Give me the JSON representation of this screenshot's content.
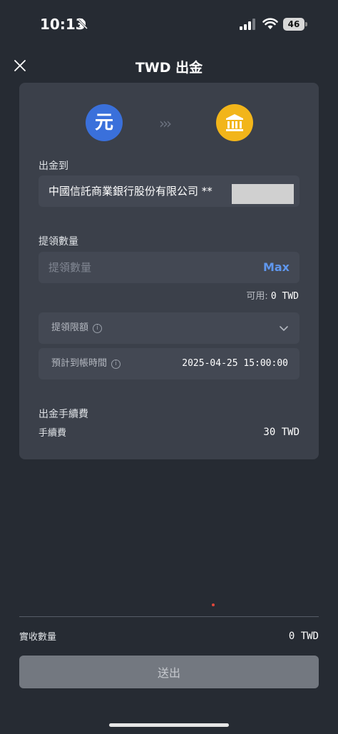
{
  "status_bar": {
    "time": "10:13",
    "battery": "46"
  },
  "header": {
    "title": "TWD 出金",
    "close_icon": "close-icon"
  },
  "flow": {
    "from_icon_text": "元",
    "arrows": "›››",
    "to_icon": "bank-icon"
  },
  "withdraw_to": {
    "label": "出金到",
    "bank_name": "中國信託商業銀行股份有限公司 **"
  },
  "amount": {
    "label": "提領數量",
    "placeholder": "提領數量",
    "max_label": "Max",
    "available_label": "可用:",
    "available_value": "0 TWD"
  },
  "limit": {
    "label": "提領限額",
    "info_icon": "ⓘ"
  },
  "eta": {
    "label": "預計到帳時間",
    "info_icon": "ⓘ",
    "value": "2025-04-25 15:00:00"
  },
  "fee": {
    "section_label": "出金手續費",
    "label": "手續費",
    "value": "30 TWD"
  },
  "footer": {
    "receive_label": "實收數量",
    "receive_value": "0 TWD",
    "submit_label": "送出"
  },
  "colors": {
    "background": "#262b33",
    "card": "#3b404a",
    "field": "#434853",
    "accent_blue": "#5f97ee",
    "coin_blue": "#3a70db",
    "bank_yellow": "#f2b51a",
    "button_disabled": "#737880"
  }
}
